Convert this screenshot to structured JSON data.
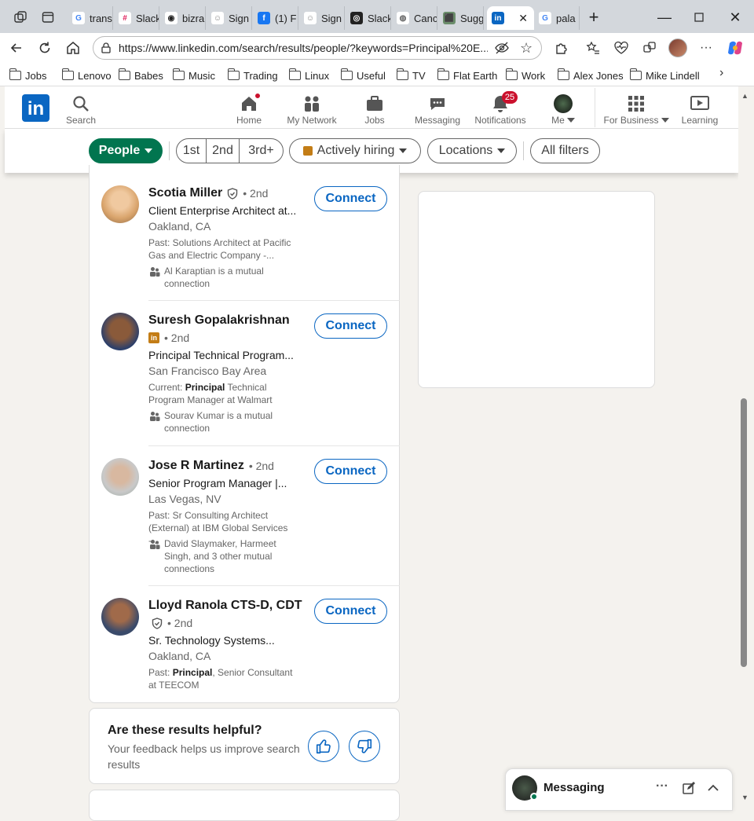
{
  "browser": {
    "tabs": [
      {
        "label": "trans",
        "fav": "G",
        "color": "#ffffff",
        "fc": "#4285f4"
      },
      {
        "label": "Slack",
        "fav": "#",
        "color": "#ffffff",
        "fc": "#e01e5a"
      },
      {
        "label": "bizra",
        "fav": "◉",
        "color": "#ffffff",
        "fc": "#222"
      },
      {
        "label": "Sign",
        "fav": "☺",
        "color": "#ffffff",
        "fc": "#888"
      },
      {
        "label": "(1) F",
        "fav": "f",
        "color": "#1877f2",
        "fc": "#fff"
      },
      {
        "label": "Sign",
        "fav": "☺",
        "color": "#ffffff",
        "fc": "#888"
      },
      {
        "label": "Slack",
        "fav": "◎",
        "color": "#222",
        "fc": "#fff"
      },
      {
        "label": "Canc",
        "fav": "◍",
        "color": "#ffffff",
        "fc": "#666"
      },
      {
        "label": "Sugg",
        "fav": "⬛",
        "color": "#6b8e6b",
        "fc": "#fff"
      },
      {
        "label": "",
        "fav": "in",
        "color": "#0a66c2",
        "fc": "#fff"
      },
      {
        "label": "pala",
        "fav": "G",
        "color": "#ffffff",
        "fc": "#4285f4"
      }
    ],
    "url": "https://www.linkedin.com/search/results/people/?keywords=Principal%20E...",
    "bookmarks": [
      "Jobs",
      "Lenovo",
      "Babes",
      "Music",
      "Trading",
      "Linux",
      "Useful",
      "TV",
      "Flat Earth",
      "Work",
      "Alex Jones",
      "Mike Lindell"
    ]
  },
  "header": {
    "search_label": "Search",
    "nav": [
      {
        "label": "Home",
        "icon": "home-icon"
      },
      {
        "label": "My Network",
        "icon": "network-icon"
      },
      {
        "label": "Jobs",
        "icon": "briefcase-icon"
      },
      {
        "label": "Messaging",
        "icon": "messaging-icon"
      },
      {
        "label": "Notifications",
        "icon": "bell-icon",
        "badge": "25"
      },
      {
        "label": "Me",
        "icon": "avatar"
      }
    ],
    "for_business": "For Business",
    "learning": "Learning"
  },
  "filters": {
    "people": "People",
    "degrees": [
      "1st",
      "2nd",
      "3rd+"
    ],
    "actively_hiring": "Actively hiring",
    "locations": "Locations",
    "all_filters": "All filters"
  },
  "results": [
    {
      "name": "Scotia Miller",
      "degree": "• 2nd",
      "headline": "Client Enterprise Architect at...",
      "location": "Oakland, CA",
      "summary_pre": "Past: Solutions Architect at Pacific Gas and Electric Company -...",
      "summary_bold": "",
      "summary_post": "",
      "mutual": "Al Karaptian is a mutual connection",
      "connect": "Connect"
    },
    {
      "name": "Suresh Gopalakrishnan",
      "degree": "• 2nd",
      "headline": "Principal Technical Program...",
      "location": "San Francisco Bay Area",
      "summary_pre": "Current: ",
      "summary_bold": "Principal",
      "summary_post": " Technical Program Manager at Walmart",
      "mutual": "Sourav Kumar is a mutual connection",
      "connect": "Connect"
    },
    {
      "name": "Jose R Martinez",
      "degree": "• 2nd",
      "headline": "Senior Program Manager |...",
      "location": "Las Vegas, NV",
      "summary_pre": "Past: Sr Consulting Architect (External) at IBM Global Services -...",
      "summary_bold": "",
      "summary_post": "",
      "mutual": "David Slaymaker, Harmeet Singh, and 3 other mutual connections",
      "connect": "Connect"
    },
    {
      "name": "Lloyd Ranola CTS-D, CDT",
      "degree": "• 2nd",
      "headline": "Sr. Technology Systems...",
      "location": "Oakland, CA",
      "summary_pre": "Past: ",
      "summary_bold": "Principal",
      "summary_post": ", Senior Consultant at TEECOM",
      "mutual": "",
      "connect": "Connect"
    }
  ],
  "feedback": {
    "title": "Are these results helpful?",
    "subtitle": "Your feedback helps us improve search results"
  },
  "messaging": {
    "label": "Messaging"
  },
  "colors": {
    "linkedin_blue": "#0a66c2",
    "people_green": "#01754f",
    "badge_red": "#cb112d"
  }
}
